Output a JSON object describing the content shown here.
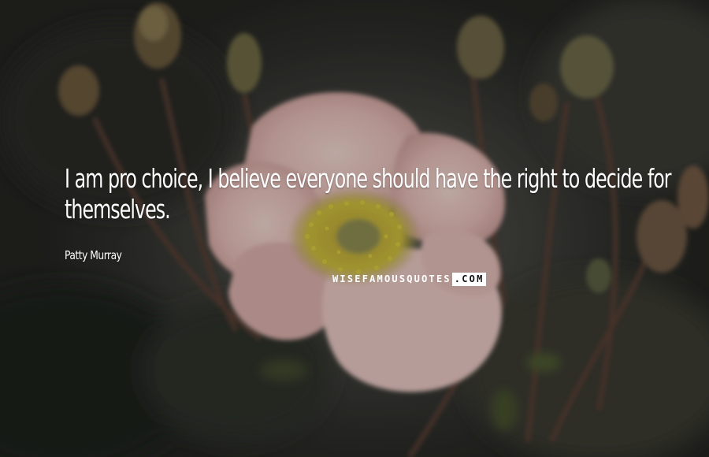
{
  "quote": {
    "text": "I am pro choice, I believe everyone should have the right to decide for themselves.",
    "author": "Patty Murray"
  },
  "watermark": {
    "part1": "WISEFAMOUSQUOTES",
    "part2": ".COM"
  },
  "colors": {
    "text": "#ffffff",
    "petal": "#e8c4c0",
    "stamen": "#c9b836",
    "background": "#2f302c"
  }
}
